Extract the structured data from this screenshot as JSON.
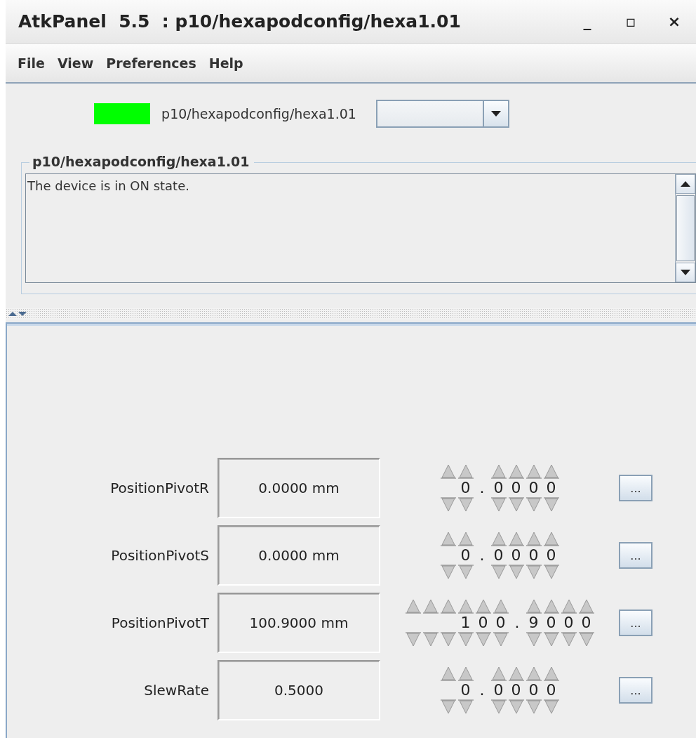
{
  "window": {
    "title": "AtkPanel  5.5  : p10/hexapodconfig/hexa1.01",
    "controls": [
      "_",
      "▫",
      "×"
    ]
  },
  "menu": [
    "File",
    "View",
    "Preferences",
    "Help"
  ],
  "device": {
    "color": "#00ff00",
    "name": "p10/hexapodconfig/hexa1.01"
  },
  "status": {
    "title": "p10/hexapodconfig/hexa1.01",
    "text": "The device is in ON state."
  },
  "attributes": [
    {
      "label": "PositionPivotR",
      "value": "0.0000 mm",
      "int_digits": [
        "0"
      ],
      "point": ".",
      "frac_digits": [
        "0",
        "0",
        "0",
        "0"
      ],
      "button": "..."
    },
    {
      "label": "PositionPivotS",
      "value": "0.0000 mm",
      "int_digits": [
        "0"
      ],
      "point": ".",
      "frac_digits": [
        "0",
        "0",
        "0",
        "0"
      ],
      "button": "..."
    },
    {
      "label": "PositionPivotT",
      "value": "100.9000 mm",
      "int_digits": [
        "1",
        "0",
        "0"
      ],
      "point": ".",
      "frac_digits": [
        "9",
        "0",
        "0",
        "0"
      ],
      "button": "..."
    },
    {
      "label": "SlewRate",
      "value": "0.5000",
      "int_digits": [
        "0"
      ],
      "point": ".",
      "frac_digits": [
        "0",
        "0",
        "0",
        "0"
      ],
      "button": "..."
    }
  ]
}
